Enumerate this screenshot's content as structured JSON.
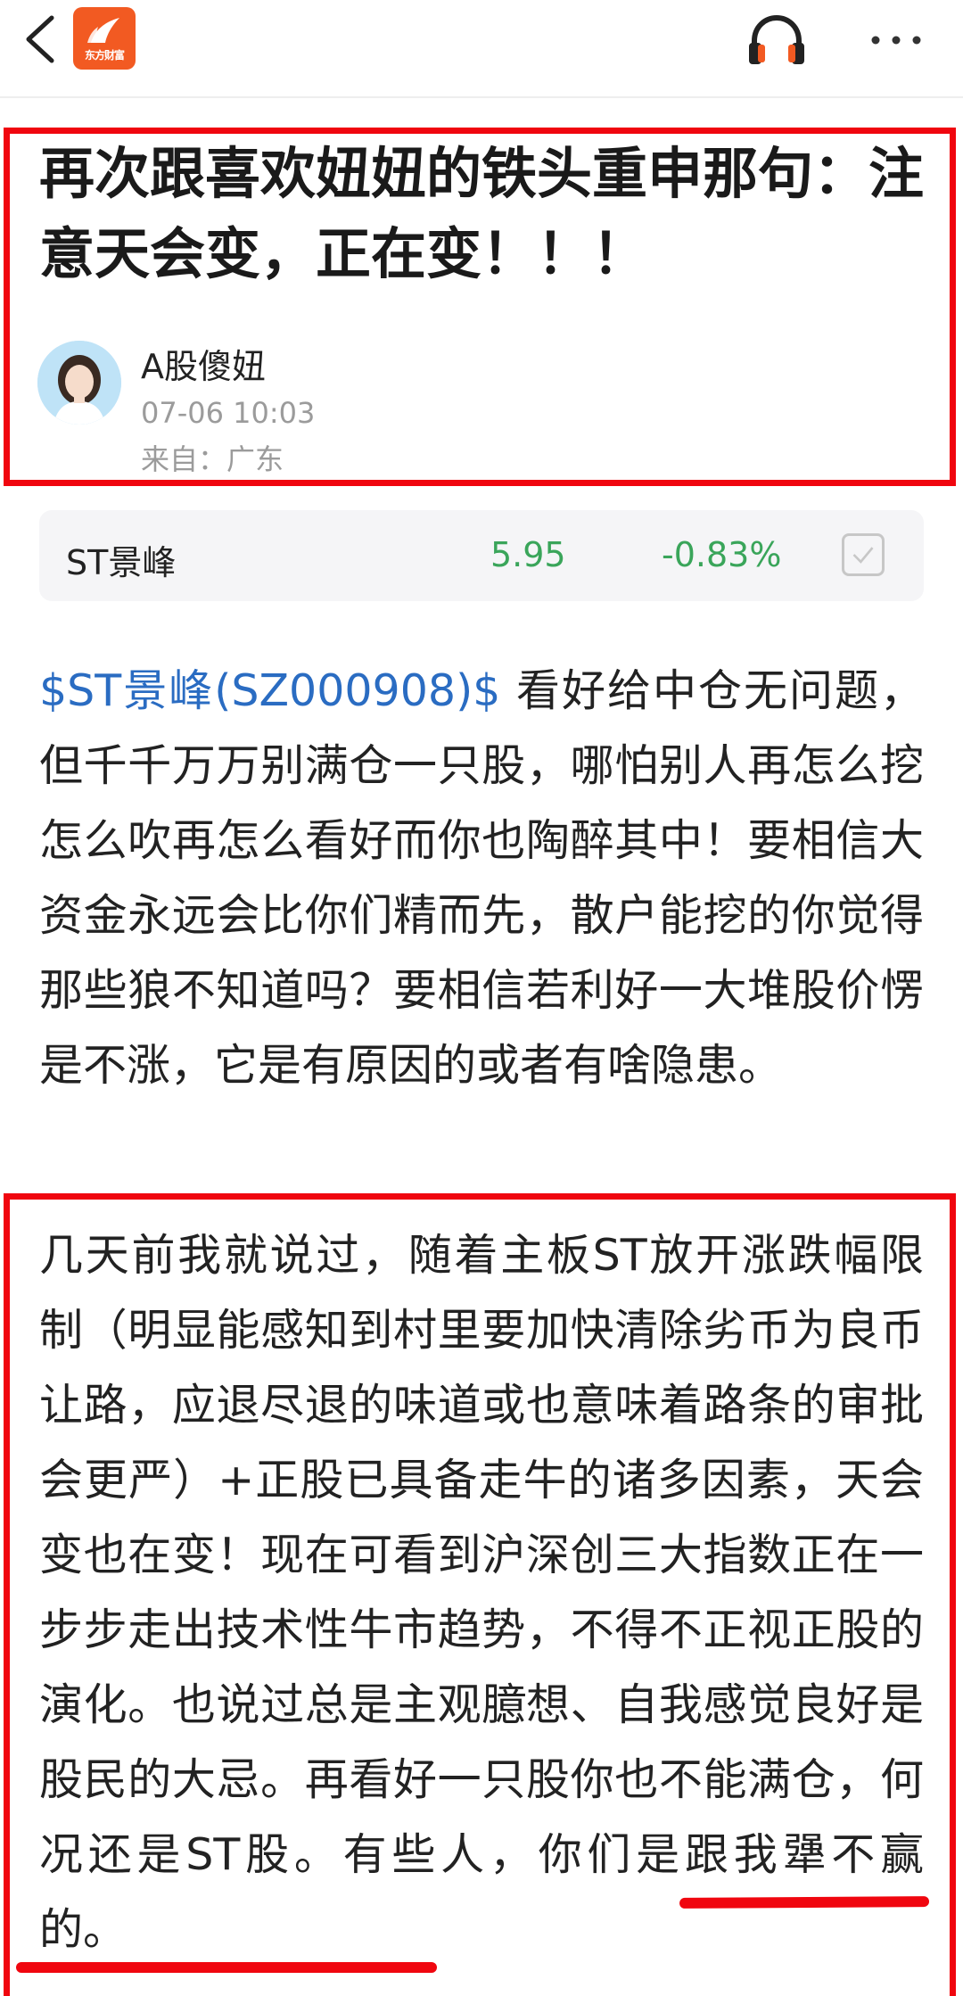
{
  "header": {
    "logo_text": "东方财富",
    "icons": [
      "back-arrow-icon",
      "eastmoney-logo",
      "headphone-icon",
      "more-dots-icon"
    ]
  },
  "article": {
    "title": "再次跟喜欢妞妞的铁头重申那句：注意天会变，正在变！！！",
    "author": "A股傻妞",
    "datetime": "07-06 10:03",
    "source": "来自：广东"
  },
  "stock_card": {
    "name": "ST景峰",
    "price": "5.95",
    "change": "-0.83%",
    "price_color": "#3aa55a"
  },
  "content": {
    "stock_tag": "$ST景峰(SZ000908)$",
    "p1_rest": "  看好给中仓无问题，但千千万万别满仓一只股，哪怕别人再怎么挖怎么吹再怎么看好而你也陶醉其中！要相信大资金永远会比你们精而先，散户能挖的你觉得那些狼不知道吗？要相信若利好一大堆股价愣是不涨，它是有原因的或者有啥隐患。",
    "p2": "几天前我就说过，随着主板ST放开涨跌幅限制（明显能感知到村里要加快清除劣币为良币让路，应退尽退的味道或也意味着路条的审批会更严）+正股已具备走牛的诸多因素，天会变也在变！现在可看到沪深创三大指数正在一步步走出技术性牛市趋势，不得不正视正股的演化。也说过总是主观臆想、自我感觉良好是股民的大忌。再看好一只股你也不能满仓，何况还是ST股。有些人，你们是跟我犟不赢的。"
  },
  "colors": {
    "annotation_red": "#f0060f",
    "link_blue": "#2a6cc2",
    "logo_orange": "#f25a22"
  }
}
